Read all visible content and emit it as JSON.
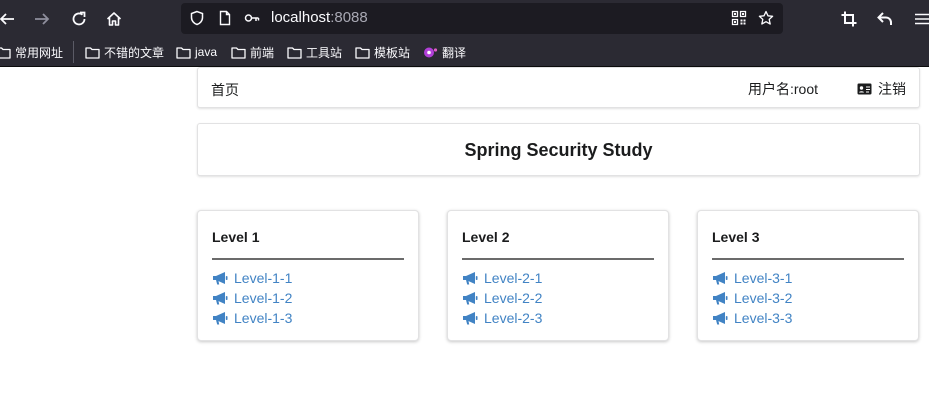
{
  "browser": {
    "url_host": "localhost",
    "url_port": ":8088",
    "bookmarks": [
      "常用网址",
      "不错的文章",
      "java",
      "前端",
      "工具站",
      "模板站",
      "翻译"
    ]
  },
  "nav": {
    "home": "首页",
    "user": "用户名:root",
    "logout": "注销"
  },
  "header": {
    "title": "Spring Security Study"
  },
  "levels": [
    {
      "title": "Level 1",
      "links": [
        "Level-1-1",
        "Level-1-2",
        "Level-1-3"
      ]
    },
    {
      "title": "Level 2",
      "links": [
        "Level-2-1",
        "Level-2-2",
        "Level-2-3"
      ]
    },
    {
      "title": "Level 3",
      "links": [
        "Level-3-1",
        "Level-3-2",
        "Level-3-3"
      ]
    }
  ],
  "colors": {
    "link": "#4183c4",
    "chrome_bg": "#2b2a33",
    "urlbar_bg": "#1c1b22"
  }
}
